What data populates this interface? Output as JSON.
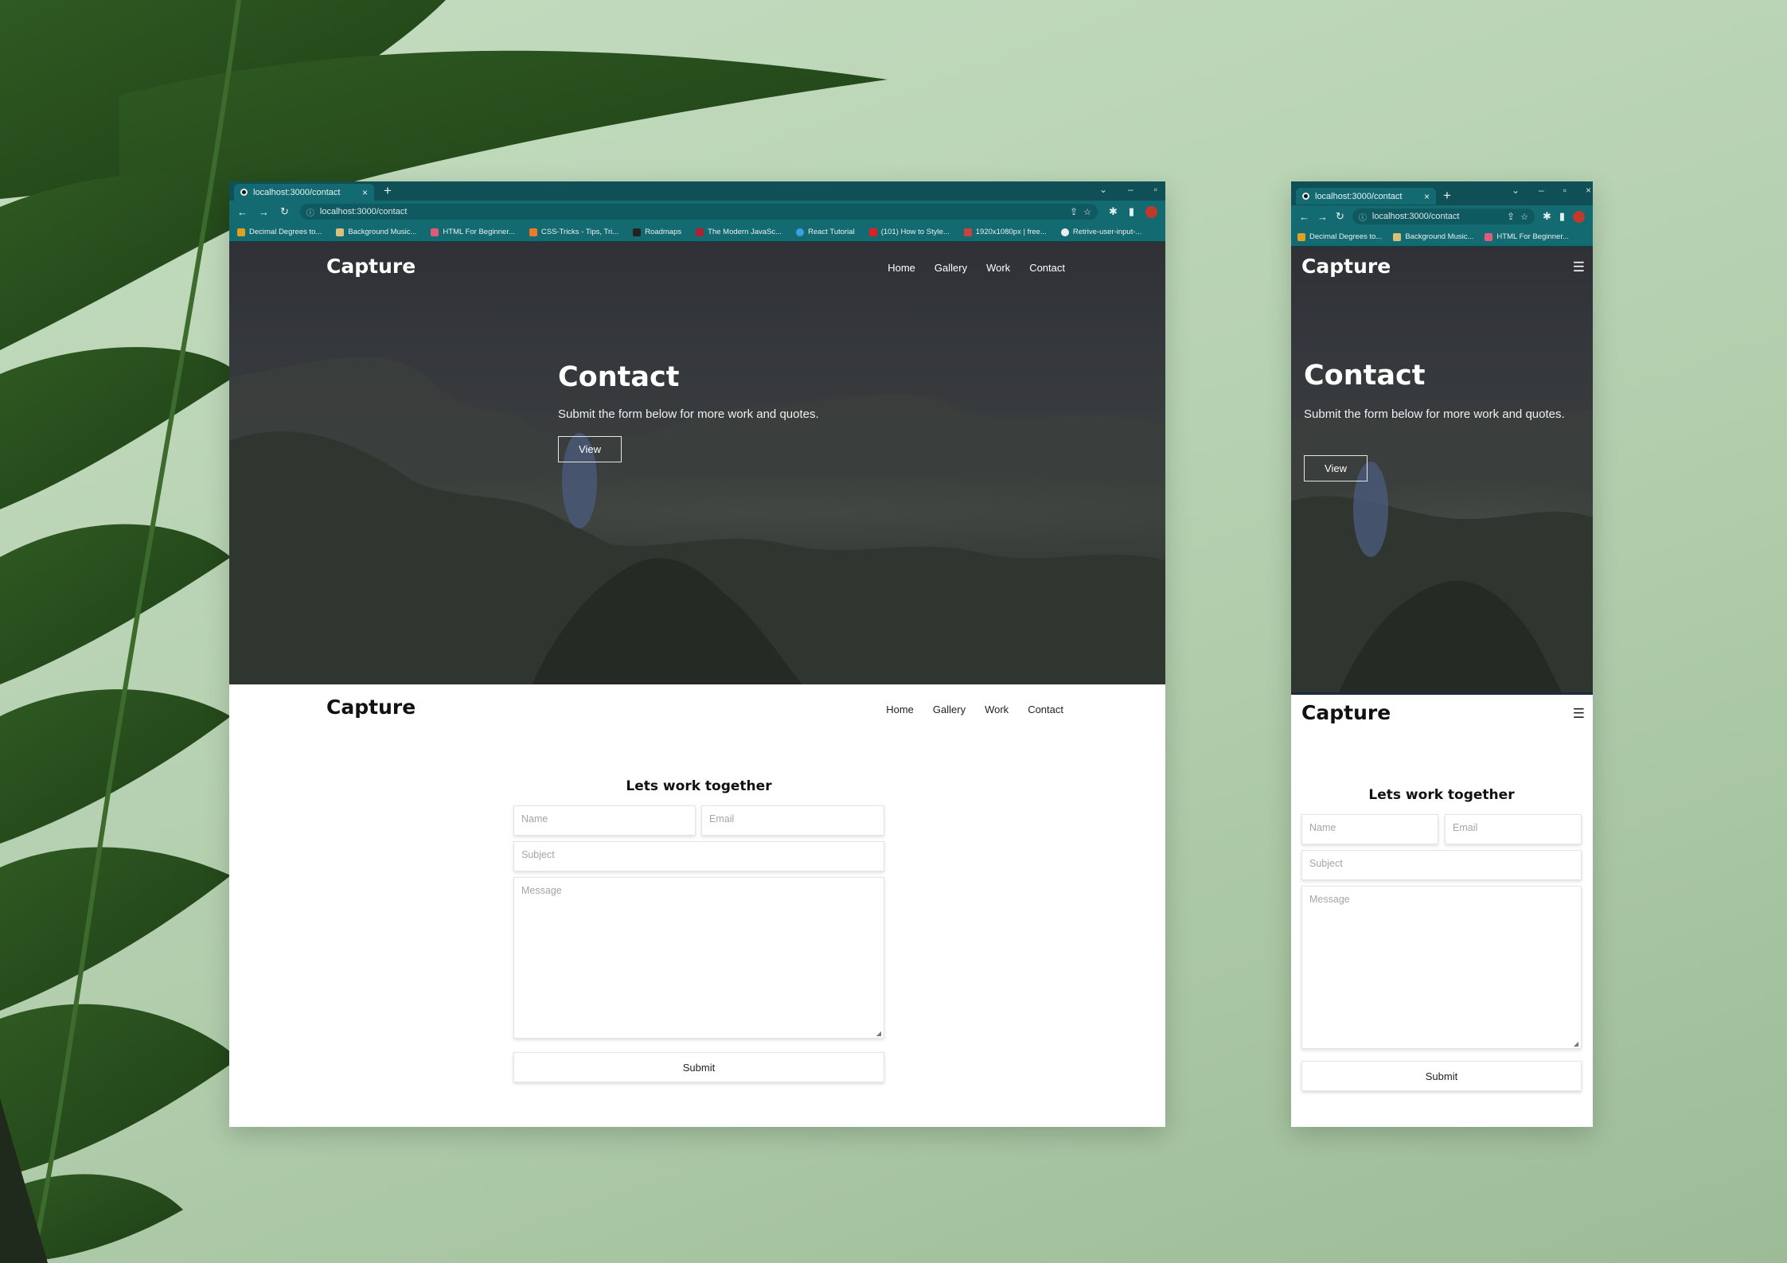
{
  "colors": {
    "background": "#b9d3b4",
    "chrome": "#0f4f55",
    "chrome_tab": "#136a71",
    "hero_overlay": "#2f3136",
    "text_light": "#ffffff",
    "text_dark": "#111111"
  },
  "desktop": {
    "tab_title": "localhost:3000/contact",
    "new_tab": "+",
    "url": "localhost:3000/contact",
    "bookmarks": [
      "Decimal Degrees to...",
      "Background Music...",
      "HTML For Beginner...",
      "CSS-Tricks - Tips, Tri...",
      "Roadmaps",
      "The Modern JavaSc...",
      "React Tutorial",
      "(101) How to Style...",
      "1920x1080px | free...",
      "Retrive-user-input-..."
    ],
    "logo": "Capture",
    "nav": [
      "Home",
      "Gallery",
      "Work",
      "Contact"
    ],
    "hero_title": "Contact",
    "hero_subtitle": "Submit the form below for more work and quotes.",
    "view_button": "View",
    "form_title": "Lets work together",
    "placeholders": {
      "name": "Name",
      "email": "Email",
      "subject": "Subject",
      "message": "Message"
    },
    "submit": "Submit"
  },
  "mobile": {
    "tab_title": "localhost:3000/contact",
    "new_tab": "+",
    "url": "localhost:3000/contact",
    "bookmarks": [
      "Decimal Degrees to...",
      "Background Music...",
      "HTML For Beginner..."
    ],
    "logo": "Capture",
    "menu_icon": "menu-icon",
    "hero_title": "Contact",
    "hero_subtitle": "Submit the form below for more work and quotes.",
    "view_button": "View",
    "form_title": "Lets work together",
    "placeholders": {
      "name": "Name",
      "email": "Email",
      "subject": "Subject",
      "message": "Message"
    },
    "submit": "Submit"
  }
}
